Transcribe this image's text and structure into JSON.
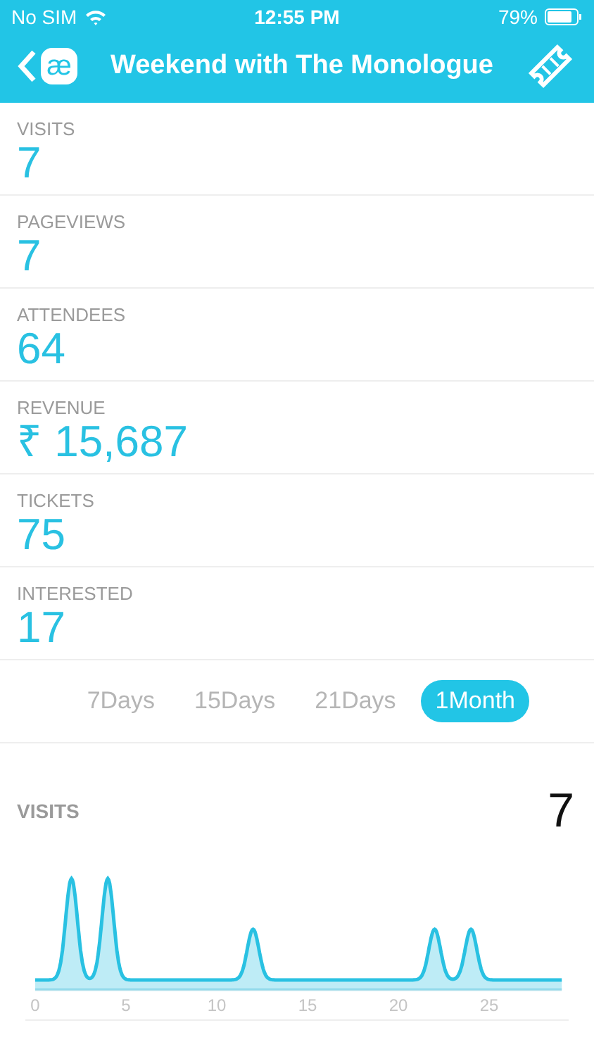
{
  "status_bar": {
    "carrier": "No SIM",
    "time": "12:55 PM",
    "battery": "79%"
  },
  "nav": {
    "logo_text": "æ",
    "title": "Weekend with The Monologue"
  },
  "stats": [
    {
      "label": "VISITS",
      "value": "7"
    },
    {
      "label": "PAGEVIEWS",
      "value": "7"
    },
    {
      "label": "ATTENDEES",
      "value": "64"
    },
    {
      "label": "REVENUE",
      "value": "₹ 15,687"
    },
    {
      "label": "TICKETS",
      "value": "75"
    },
    {
      "label": "INTERESTED",
      "value": "17"
    }
  ],
  "ranges": [
    {
      "label": "7Days",
      "selected": false
    },
    {
      "label": "15Days",
      "selected": false
    },
    {
      "label": "21Days",
      "selected": false
    },
    {
      "label": "1Month",
      "selected": true
    }
  ],
  "chart": {
    "title": "VISITS",
    "total": "7",
    "axis_labels": [
      "0",
      "5",
      "10",
      "15",
      "20",
      "25"
    ]
  }
}
